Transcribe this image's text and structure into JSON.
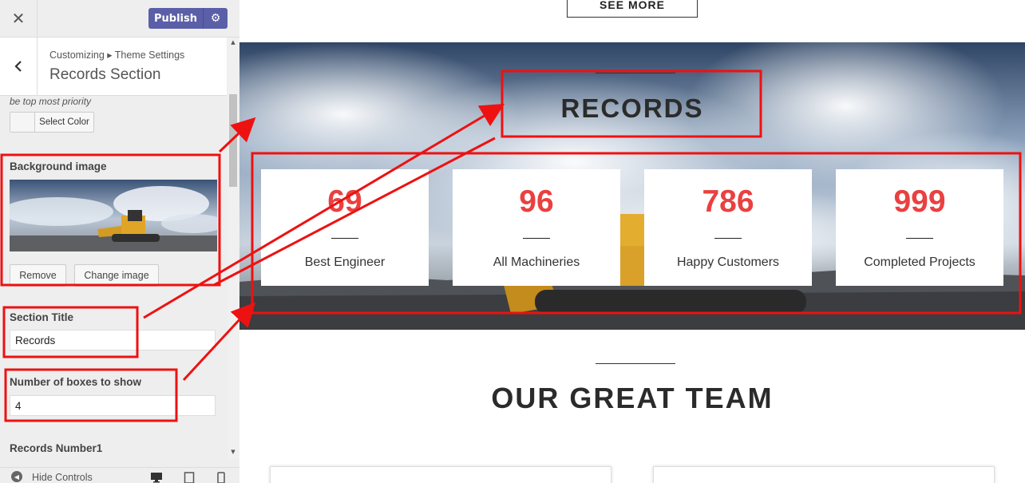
{
  "colors": {
    "accent": "#5b5fa8",
    "number_red": "#ea4040",
    "annotation_red": "#ee1111"
  },
  "topbar": {
    "close_glyph": "✕",
    "publish_label": "Publish",
    "gear_glyph": "⚙"
  },
  "panel": {
    "back_glyph": "‹",
    "breadcrumb": "Customizing ▸ Theme Settings",
    "title": "Records Section"
  },
  "controls": {
    "priority_note": "be top most priority",
    "select_color_label": "Select Color",
    "background_image_label": "Background image",
    "remove_label": "Remove",
    "change_image_label": "Change image",
    "section_title_label": "Section Title",
    "section_title_value": "Records",
    "boxes_label": "Number of boxes to show",
    "boxes_value": "4",
    "records_number_label": "Records Number1"
  },
  "footer": {
    "hide_label": "Hide Controls",
    "hide_glyph": "◀",
    "devices": [
      "desktop-icon",
      "tablet-icon",
      "mobile-icon"
    ]
  },
  "preview": {
    "see_more": "SEE MORE",
    "records_title": "RECORDS",
    "records": [
      {
        "number": "69",
        "label": "Best Engineer"
      },
      {
        "number": "96",
        "label": "All Machineries"
      },
      {
        "number": "786",
        "label": "Happy Customers"
      },
      {
        "number": "999",
        "label": "Completed Projects"
      }
    ],
    "team_title": "OUR GREAT TEAM"
  }
}
